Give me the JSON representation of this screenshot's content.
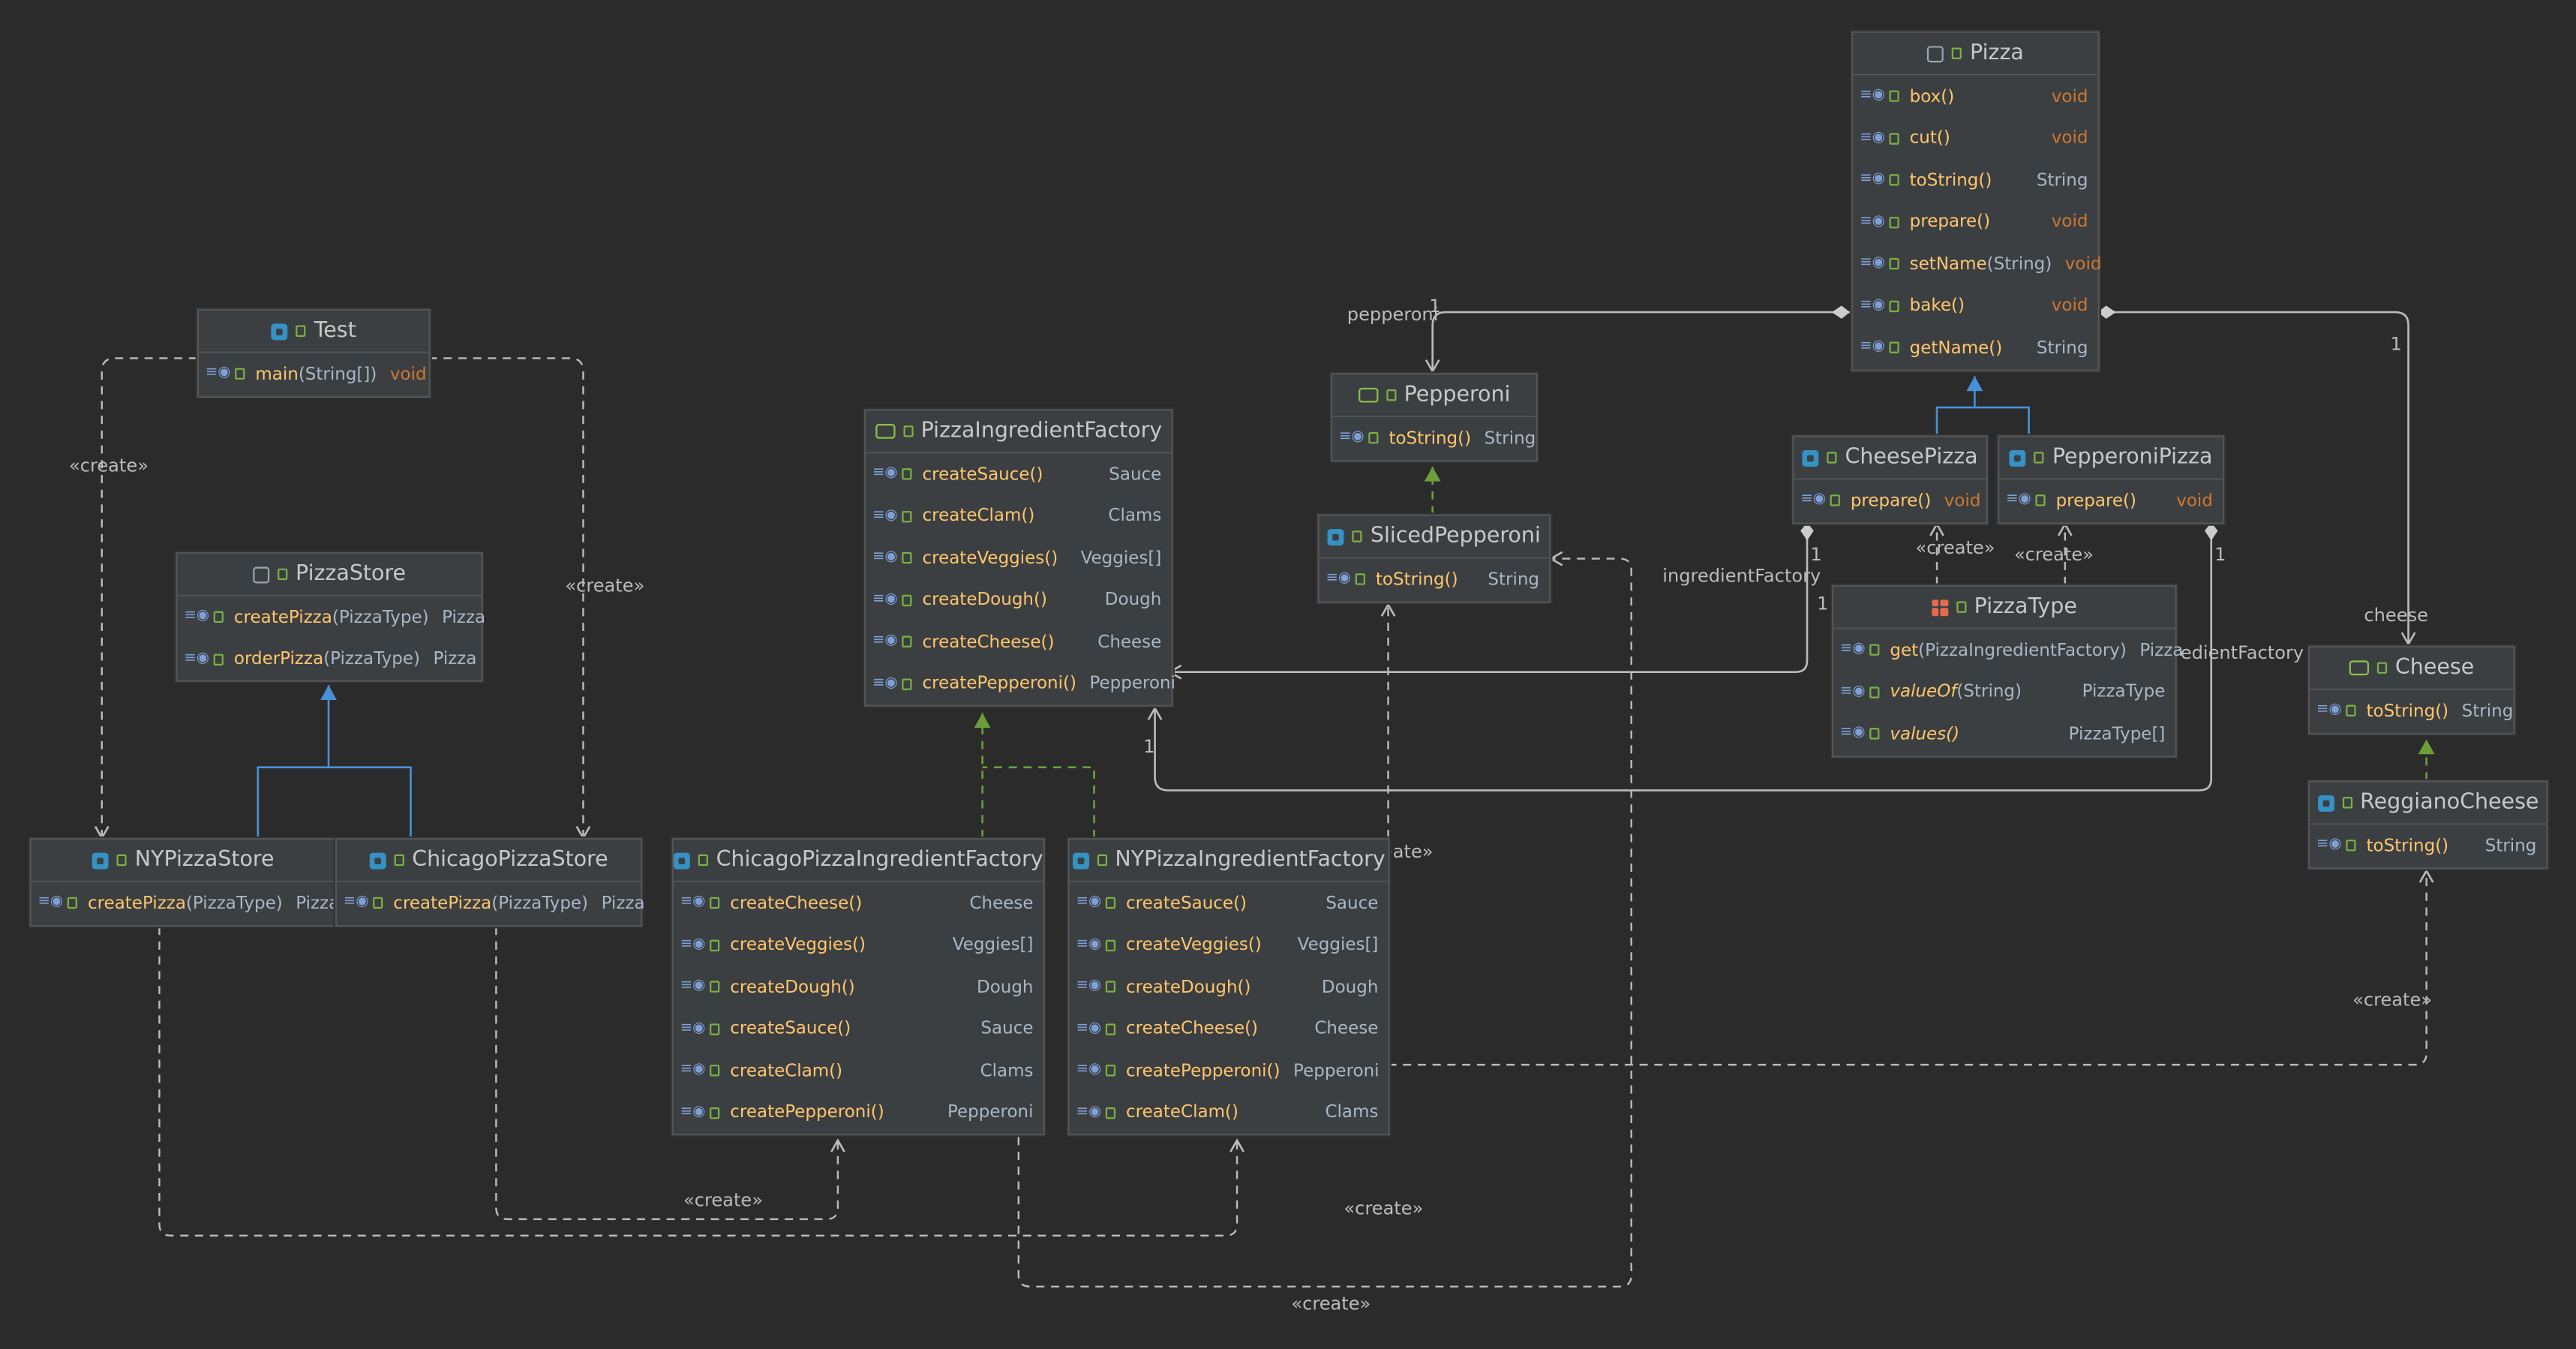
{
  "nodes": {
    "pizza": {
      "title": "Pizza",
      "methods": [
        {
          "name": "box()",
          "params": "",
          "type": "void"
        },
        {
          "name": "cut()",
          "params": "",
          "type": "void"
        },
        {
          "name": "toString()",
          "params": "",
          "type": "String"
        },
        {
          "name": "prepare()",
          "params": "",
          "type": "void"
        },
        {
          "name": "setName",
          "params": "(String)",
          "type": "void"
        },
        {
          "name": "bake()",
          "params": "",
          "type": "void"
        },
        {
          "name": "getName()",
          "params": "",
          "type": "String"
        }
      ]
    },
    "test": {
      "title": "Test",
      "methods": [
        {
          "name": "main",
          "params": "(String[])",
          "type": "void"
        }
      ]
    },
    "pepperoni": {
      "title": "Pepperoni",
      "methods": [
        {
          "name": "toString()",
          "params": "",
          "type": "String"
        }
      ]
    },
    "pizza_ingredient_factory": {
      "title": "PizzaIngredientFactory",
      "methods": [
        {
          "name": "createSauce()",
          "params": "",
          "type": "Sauce"
        },
        {
          "name": "createClam()",
          "params": "",
          "type": "Clams"
        },
        {
          "name": "createVeggies()",
          "params": "",
          "type": "Veggies[]"
        },
        {
          "name": "createDough()",
          "params": "",
          "type": "Dough"
        },
        {
          "name": "createCheese()",
          "params": "",
          "type": "Cheese"
        },
        {
          "name": "createPepperoni()",
          "params": "",
          "type": "Pepperoni"
        }
      ]
    },
    "cheese_pizza": {
      "title": "CheesePizza",
      "methods": [
        {
          "name": "prepare()",
          "params": "",
          "type": "void"
        }
      ]
    },
    "pepperoni_pizza": {
      "title": "PepperoniPizza",
      "methods": [
        {
          "name": "prepare()",
          "params": "",
          "type": "void"
        }
      ]
    },
    "sliced_pepperoni": {
      "title": "SlicedPepperoni",
      "methods": [
        {
          "name": "toString()",
          "params": "",
          "type": "String"
        }
      ]
    },
    "pizza_store": {
      "title": "PizzaStore",
      "methods": [
        {
          "name": "createPizza",
          "params": "(PizzaType)",
          "type": "Pizza"
        },
        {
          "name": "orderPizza",
          "params": "(PizzaType)",
          "type": "Pizza"
        }
      ]
    },
    "pizza_type": {
      "title": "PizzaType",
      "methods": [
        {
          "name": "get",
          "params": "(PizzaIngredientFactory)",
          "type": "Pizza"
        },
        {
          "name": "valueOf",
          "params": "(String)",
          "type": "PizzaType"
        },
        {
          "name": "values()",
          "params": "",
          "type": "PizzaType[]"
        }
      ]
    },
    "cheese": {
      "title": "Cheese",
      "methods": [
        {
          "name": "toString()",
          "params": "",
          "type": "String"
        }
      ]
    },
    "reggiano_cheese": {
      "title": "ReggianoCheese",
      "methods": [
        {
          "name": "toString()",
          "params": "",
          "type": "String"
        }
      ]
    },
    "ny_pizza_store": {
      "title": "NYPizzaStore",
      "methods": [
        {
          "name": "createPizza",
          "params": "(PizzaType)",
          "type": "Pizza"
        }
      ]
    },
    "chicago_pizza_store": {
      "title": "ChicagoPizzaStore",
      "methods": [
        {
          "name": "createPizza",
          "params": "(PizzaType)",
          "type": "Pizza"
        }
      ]
    },
    "chicago_factory": {
      "title": "ChicagoPizzaIngredientFactory",
      "methods": [
        {
          "name": "createCheese()",
          "params": "",
          "type": "Cheese"
        },
        {
          "name": "createVeggies()",
          "params": "",
          "type": "Veggies[]"
        },
        {
          "name": "createDough()",
          "params": "",
          "type": "Dough"
        },
        {
          "name": "createSauce()",
          "params": "",
          "type": "Sauce"
        },
        {
          "name": "createClam()",
          "params": "",
          "type": "Clams"
        },
        {
          "name": "createPepperoni()",
          "params": "",
          "type": "Pepperoni"
        }
      ]
    },
    "ny_factory": {
      "title": "NYPizzaIngredientFactory",
      "methods": [
        {
          "name": "createSauce()",
          "params": "",
          "type": "Sauce"
        },
        {
          "name": "createVeggies()",
          "params": "",
          "type": "Veggies[]"
        },
        {
          "name": "createDough()",
          "params": "",
          "type": "Dough"
        },
        {
          "name": "createCheese()",
          "params": "",
          "type": "Cheese"
        },
        {
          "name": "createPepperoni()",
          "params": "",
          "type": "Pepperoni"
        },
        {
          "name": "createClam()",
          "params": "",
          "type": "Clams"
        }
      ]
    }
  },
  "edge_labels": {
    "create": "«create»",
    "pepperoni": "pepperoni",
    "ingredient_factory": "ingredientFactory",
    "cheese": "cheese",
    "one": "1"
  },
  "colors": {
    "background": "#2b2b2b",
    "node_fill": "#3c3f41",
    "method_name": "#ffc66d",
    "void_type": "#cc7832",
    "inheritance_edge": "#4a90d9",
    "realization_edge": "#6a9f3a",
    "association_edge": "#bbbbbb"
  }
}
